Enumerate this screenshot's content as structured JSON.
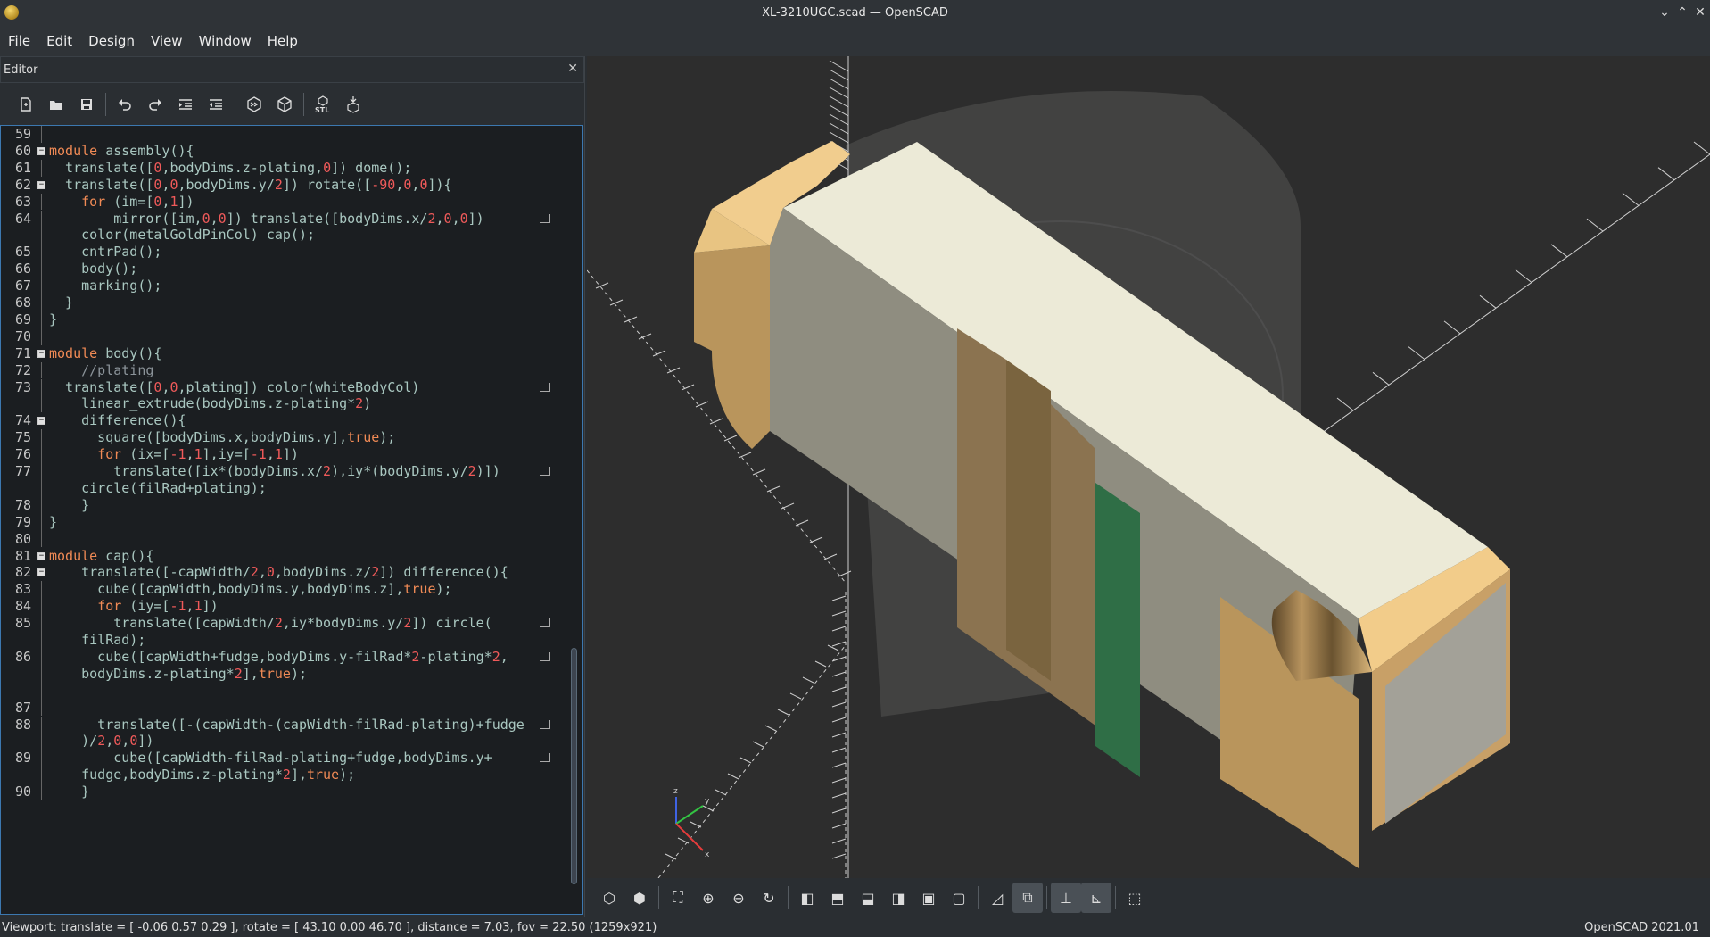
{
  "window": {
    "title": "XL-3210UGC.scad — OpenSCAD",
    "minimize": "⌄",
    "maximize": "⌃",
    "close": "✕"
  },
  "menu": [
    "File",
    "Edit",
    "Design",
    "View",
    "Window",
    "Help"
  ],
  "editor": {
    "title": "Editor",
    "close_label": "✕",
    "lines": [
      {
        "n": "59",
        "fold": false,
        "html": ""
      },
      {
        "n": "60",
        "fold": true,
        "html": "<span class='kw'>module</span> assembly(){"
      },
      {
        "n": "61",
        "fold": false,
        "html": "  translate([<span class='num'>0</span>,bodyDims.z-plating,<span class='num'>0</span>]) dome();"
      },
      {
        "n": "62",
        "fold": true,
        "html": "  translate([<span class='num'>0</span>,<span class='num'>0</span>,bodyDims.y/<span class='num'>2</span>]) rotate([<span class='num'>-90</span>,<span class='num'>0</span>,<span class='num'>0</span>]){"
      },
      {
        "n": "63",
        "fold": false,
        "html": "    <span class='kw'>for</span> (im=[<span class='num'>0</span>,<span class='num'>1</span>])"
      },
      {
        "n": "64",
        "fold": false,
        "wrap": true,
        "html": "        mirror([im,<span class='num'>0</span>,<span class='num'>0</span>]) translate([bodyDims.x/<span class='num'>2</span>,<span class='num'>0</span>,<span class='num'>0</span>])"
      },
      {
        "n": "",
        "fold": false,
        "html": "    color(metalGoldPinCol) cap();"
      },
      {
        "n": "65",
        "fold": false,
        "html": "    cntrPad();"
      },
      {
        "n": "66",
        "fold": false,
        "html": "    body();"
      },
      {
        "n": "67",
        "fold": false,
        "html": "    marking();"
      },
      {
        "n": "68",
        "fold": false,
        "html": "  }"
      },
      {
        "n": "69",
        "fold": false,
        "html": "}"
      },
      {
        "n": "70",
        "fold": false,
        "html": ""
      },
      {
        "n": "71",
        "fold": true,
        "html": "<span class='kw'>module</span> body(){"
      },
      {
        "n": "72",
        "fold": false,
        "html": "    <span class='cm'>//plating</span>"
      },
      {
        "n": "73",
        "fold": false,
        "wrap": true,
        "html": "  translate([<span class='num'>0</span>,<span class='num'>0</span>,plating]) color(whiteBodyCol)"
      },
      {
        "n": "",
        "fold": false,
        "html": "    linear_extrude(bodyDims.z-plating*<span class='num'>2</span>)"
      },
      {
        "n": "74",
        "fold": true,
        "html": "    difference(){"
      },
      {
        "n": "75",
        "fold": false,
        "html": "      square([bodyDims.x,bodyDims.y],<span class='kw'>true</span>);"
      },
      {
        "n": "76",
        "fold": false,
        "html": "      <span class='kw'>for</span> (ix=[<span class='num'>-1</span>,<span class='num'>1</span>],iy=[<span class='num'>-1</span>,<span class='num'>1</span>])"
      },
      {
        "n": "77",
        "fold": false,
        "wrap": true,
        "html": "        translate([ix*(bodyDims.x/<span class='num'>2</span>),iy*(bodyDims.y/<span class='num'>2</span>)])"
      },
      {
        "n": "",
        "fold": false,
        "html": "    circle(filRad+plating);"
      },
      {
        "n": "78",
        "fold": false,
        "html": "    }"
      },
      {
        "n": "79",
        "fold": false,
        "html": "}"
      },
      {
        "n": "80",
        "fold": false,
        "html": ""
      },
      {
        "n": "81",
        "fold": true,
        "html": "<span class='kw'>module</span> cap(){"
      },
      {
        "n": "82",
        "fold": true,
        "html": "    translate([-capWidth/<span class='num'>2</span>,<span class='num'>0</span>,bodyDims.z/<span class='num'>2</span>]) difference(){"
      },
      {
        "n": "83",
        "fold": false,
        "html": "      cube([capWidth,bodyDims.y,bodyDims.z],<span class='kw'>true</span>);"
      },
      {
        "n": "84",
        "fold": false,
        "html": "      <span class='kw'>for</span> (iy=[<span class='num'>-1</span>,<span class='num'>1</span>])"
      },
      {
        "n": "85",
        "fold": false,
        "wrap": true,
        "html": "        translate([capWidth/<span class='num'>2</span>,iy*bodyDims.y/<span class='num'>2</span>]) circle("
      },
      {
        "n": "",
        "fold": false,
        "html": "    filRad);"
      },
      {
        "n": "86",
        "fold": false,
        "wrap": true,
        "html": "      cube([capWidth+fudge,bodyDims.y-filRad*<span class='num'>2</span>-plating*<span class='num'>2</span>,"
      },
      {
        "n": "",
        "fold": false,
        "html": "    bodyDims.z-plating*<span class='num'>2</span>],<span class='kw'>true</span>);"
      },
      {
        "n": "",
        "fold": false,
        "html": ""
      },
      {
        "n": "87",
        "fold": false,
        "html": ""
      },
      {
        "n": "88",
        "fold": false,
        "wrap": true,
        "html": "      translate([-(capWidth-(capWidth-filRad-plating)+fudge"
      },
      {
        "n": "",
        "fold": false,
        "html": "    )/<span class='num'>2</span>,<span class='num'>0</span>,<span class='num'>0</span>])"
      },
      {
        "n": "89",
        "fold": false,
        "wrap": true,
        "html": "        cube([capWidth-filRad-plating+fudge,bodyDims.y+"
      },
      {
        "n": "",
        "fold": false,
        "html": "    fudge,bodyDims.z-plating*<span class='num'>2</span>],<span class='kw'>true</span>);"
      },
      {
        "n": "90",
        "fold": false,
        "html": "    }"
      }
    ]
  },
  "toolbar_icons": [
    "new-file-icon",
    "open-file-icon",
    "save-icon",
    "undo-icon",
    "redo-icon",
    "indent-icon",
    "unindent-icon",
    "preview-icon",
    "render-icon",
    "export-stl-icon",
    "send-to-print-icon"
  ],
  "stl_label": "STL",
  "axis_labels": {
    "x": "x",
    "y": "y",
    "z": "z"
  },
  "viewport_toolbar": [
    "preview-icon",
    "render-icon",
    "view-all-icon",
    "zoom-in-icon",
    "zoom-out-icon",
    "reset-view-icon",
    "view-right-icon",
    "view-top-icon",
    "view-bottom-icon",
    "view-left-icon",
    "view-front-icon",
    "view-back-icon",
    "perspective-icon",
    "orthogonal-icon",
    "show-axes-icon",
    "show-scale-markers-icon",
    "show-edges-icon"
  ],
  "status": {
    "viewport": "Viewport: translate = [ -0.06 0.57 0.29 ], rotate = [ 43.10 0.00 46.70 ], distance = 7.03, fov = 22.50 (1259x921)",
    "version": "OpenSCAD 2021.01"
  }
}
